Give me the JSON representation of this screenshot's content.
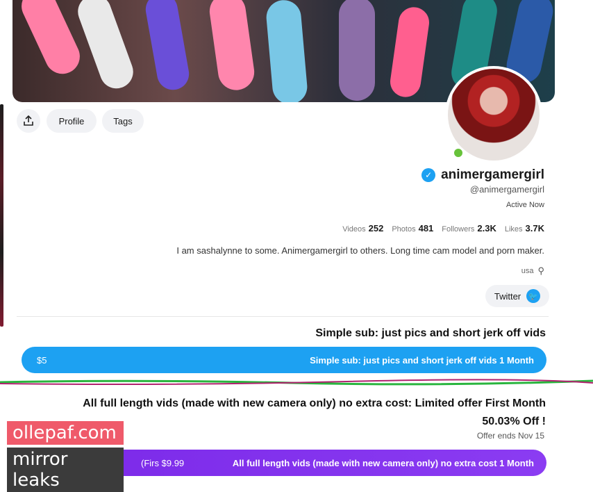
{
  "profile": {
    "display_name": "animergamergirl",
    "handle": "@animergamergirl",
    "status": "Active Now",
    "bio": "I am sashalynne to some. Animergamergirl to others. Long time cam model and porn maker.",
    "location": "usa"
  },
  "actions": {
    "tags_label": "Tags",
    "profile_label": "Profile"
  },
  "stats": {
    "likes_value": "3.7K",
    "likes_label": "Likes",
    "followers_value": "2.3K",
    "followers_label": "Followers",
    "photos_value": "481",
    "photos_label": "Photos",
    "videos_value": "252",
    "videos_label": "Videos"
  },
  "social": {
    "twitter_label": "Twitter"
  },
  "tiers": [
    {
      "title": "Simple sub: just pics and short jerk off vids",
      "button_label": "Simple sub: just pics and short jerk off vids 1 Month",
      "price": "$5"
    },
    {
      "title": "All full length vids (made with new camera only) no extra cost: Limited offer First Month",
      "discount": "50.03% Off !",
      "offer_ends": "Offer ends Nov 15",
      "button_label": "All full length vids (made with new camera only) no extra cost 1 Month",
      "price": "$9.99",
      "price_note": "(Firs"
    }
  ],
  "watermark": {
    "line1": "ollepaf.com",
    "line2": "mirror leaks"
  },
  "colors": {
    "accent_blue": "#1da1f2",
    "accent_purple": "#7b2ff7",
    "online_green": "#67c23a"
  }
}
